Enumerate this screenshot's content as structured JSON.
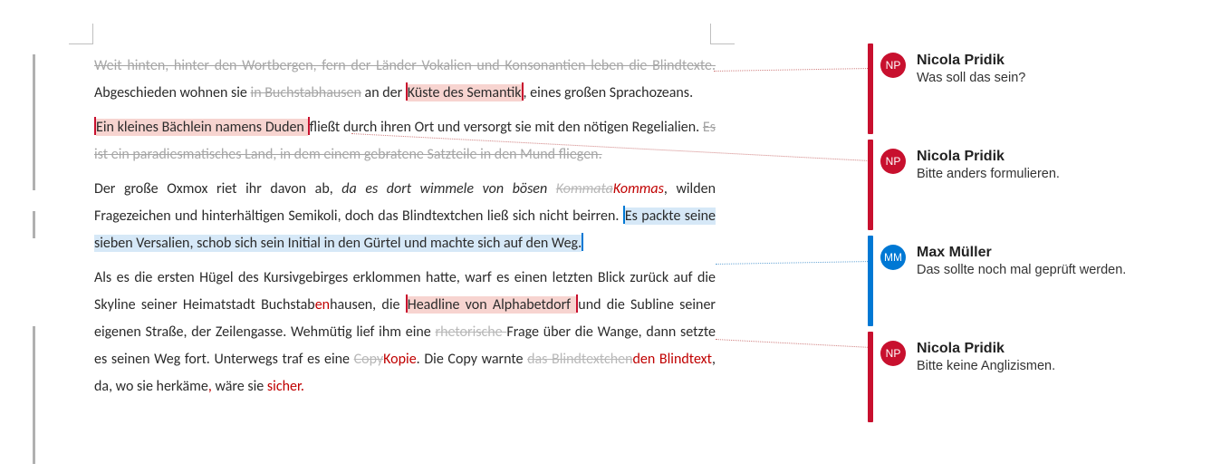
{
  "para1": {
    "del1": "Weit hinten, hinter den Wortbergen, fern der Länder Vokalien und Konsonantien leben die Blindtexte.",
    "t1": " Abgeschieden wohnen sie ",
    "del2": "in Buchstabhausen",
    "t2": " an der ",
    "hl1": "Küste des Semantik",
    "t3": ", eines großen Sprachozeans."
  },
  "para2": {
    "hl1": "Ein kleines Bächlein namens Duden ",
    "t1": "fließt durch ihren Ort und versorgt sie mit den nötigen Regelialien. ",
    "del1": "Es ist ein paradiesmatisches Land, in dem einem gebratene Satzteile in den Mund fliegen."
  },
  "para3": {
    "t1": "Der große Oxmox riet ihr davon ab, ",
    "it1": "da es dort wimmele von bösen ",
    "del1": "Kommata",
    "ins1": "Kommas",
    "t2": ", wilden Fragezeichen und hinterhältigen Semikoli, doch das Blindtextchen ließ sich nicht beirren",
    "ins2_period": ". ",
    "hl1": "Es packte seine sieben Versalien, schob sich sein Initial in den Gürtel und machte sich auf den Weg."
  },
  "para4": {
    "t1": "Als es die ersten Hügel des Kursivgebirges erklommen hatte, warf es einen letzten Blick zurück auf die Skyline seiner Heimatstadt Buchstab",
    "ins1": "en",
    "t2": "hausen, die ",
    "hl1": "Headline von Alphabetdorf ",
    "t3": "und die Subline seiner eigenen Straße, der Zeilengasse. Wehmütig lief ihm eine ",
    "del1": "rhetorische ",
    "t4": "Frage über die Wange, dann setzte es seinen Weg fort. Unterwegs traf es eine ",
    "del2": "Copy",
    "ins2": "Kopie",
    "t5": ". Die Copy warnte ",
    "del3": "das Blindtextchen",
    "ins3": "den Blindtext",
    "t6": ", da, wo sie herkäme",
    "ins4": ",",
    "t7": " wäre sie ",
    "ins5": "sicher."
  },
  "comments": [
    {
      "initials": "NP",
      "author": "Nicola Pridik",
      "text": "Was soll das sein?",
      "color": "red"
    },
    {
      "initials": "NP",
      "author": "Nicola Pridik",
      "text": "Bitte anders formulieren.",
      "color": "red"
    },
    {
      "initials": "MM",
      "author": "Max Müller",
      "text": "Das sollte noch mal geprüft werden.",
      "color": "blue"
    },
    {
      "initials": "NP",
      "author": "Nicola Pridik",
      "text": "Bitte keine Anglizismen.",
      "color": "red"
    }
  ]
}
